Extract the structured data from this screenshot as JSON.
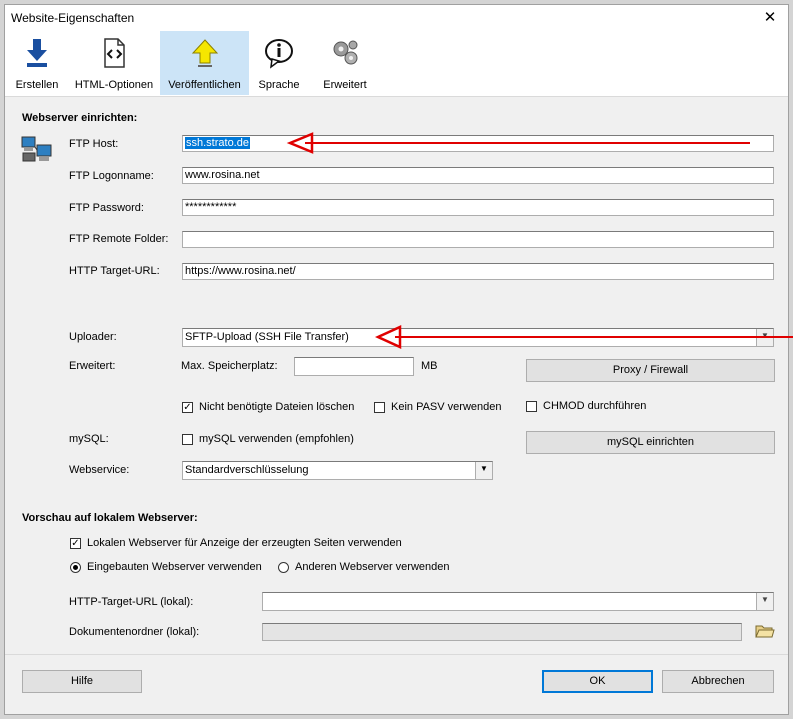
{
  "window": {
    "title": "Website-Eigenschaften",
    "close_symbol": "✕"
  },
  "toolbar": {
    "items": [
      {
        "label": "Erstellen",
        "icon": "download-arrow-icon",
        "selected": false
      },
      {
        "label": "HTML-Optionen",
        "icon": "html-code-icon",
        "selected": false
      },
      {
        "label": "Veröffentlichen",
        "icon": "upload-arrow-icon",
        "selected": true
      },
      {
        "label": "Sprache",
        "icon": "info-bubble-icon",
        "selected": false
      },
      {
        "label": "Erweitert",
        "icon": "gears-icon",
        "selected": false
      }
    ]
  },
  "webserver": {
    "section_title": "Webserver einrichten:",
    "ftp_host": {
      "label": "FTP Host:",
      "value": "ssh.strato.de"
    },
    "ftp_login": {
      "label": "FTP Logonname:",
      "value": "www.rosina.net"
    },
    "ftp_password": {
      "label": "FTP Password:",
      "value": "************"
    },
    "ftp_remote": {
      "label": "FTP Remote Folder:",
      "value": ""
    },
    "http_target": {
      "label": "HTTP Target-URL:",
      "value": "https://www.rosina.net/"
    },
    "uploader": {
      "label": "Uploader:",
      "value": "SFTP-Upload (SSH File Transfer)"
    },
    "erweitert_label": "Erweitert:",
    "max_storage": {
      "label": "Max. Speicherplatz:",
      "value": "",
      "unit": "MB"
    },
    "proxy_button": "Proxy / Firewall",
    "delete_unneeded": {
      "label": "Nicht benötigte Dateien löschen",
      "checked": true
    },
    "no_pasv": {
      "label": "Kein PASV verwenden",
      "checked": false
    },
    "chmod": {
      "label": "CHMOD durchführen",
      "checked": false
    },
    "mysql_label": "mySQL:",
    "mysql_use": {
      "label": "mySQL verwenden (empfohlen)",
      "checked": false
    },
    "mysql_button": "mySQL einrichten",
    "webservice": {
      "label": "Webservice:",
      "value": "Standardverschlüsselung"
    }
  },
  "preview": {
    "section_title": "Vorschau auf lokalem Webserver:",
    "use_local": {
      "label": "Lokalen Webserver für Anzeige der erzeugten Seiten verwenden",
      "checked": true
    },
    "builtin": {
      "label": "Eingebauten Webserver verwenden",
      "selected": true
    },
    "other": {
      "label": "Anderen Webserver verwenden",
      "selected": false
    },
    "http_local": {
      "label": "HTTP-Target-URL (lokal):",
      "value": ""
    },
    "doc_folder": {
      "label": "Dokumentenordner (lokal):",
      "value": ""
    }
  },
  "buttons": {
    "help": "Hilfe",
    "ok": "OK",
    "cancel": "Abbrechen"
  },
  "colors": {
    "selection": "#0078d7",
    "annotation_arrow": "#e00000",
    "toolbar_selected": "#cce4f7"
  }
}
